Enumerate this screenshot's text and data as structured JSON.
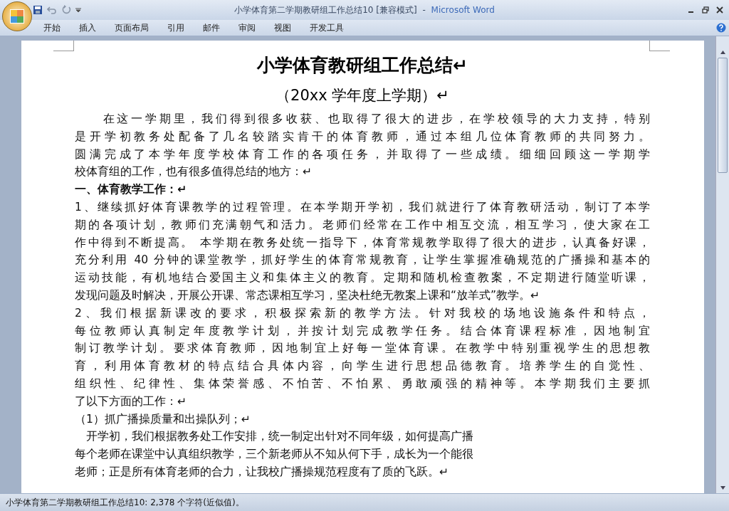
{
  "window": {
    "title": "小学体育第二学期教研组工作总结10 [兼容模式]",
    "separator": "-",
    "app_name": "Microsoft Word"
  },
  "ribbon_tabs": [
    {
      "label": "开始",
      "selected": false
    },
    {
      "label": "插入",
      "selected": false
    },
    {
      "label": "页面布局",
      "selected": false
    },
    {
      "label": "引用",
      "selected": false
    },
    {
      "label": "邮件",
      "selected": false
    },
    {
      "label": "审阅",
      "selected": false
    },
    {
      "label": "视图",
      "selected": false
    },
    {
      "label": "开发工具",
      "selected": false
    }
  ],
  "document": {
    "title": "小学体育教研组工作总结↵",
    "subtitle": "（20xx 学年度上学期）↵",
    "paragraphs": [
      {
        "kind": "body",
        "lines": [
          "　　在这一学期里，我们得到很多收获、也取得了很大的进步，在学校领导的大力支持，特别",
          "是开学初教务处配备了几名较踏实肯干的体育教师，通过本组几位体育教师的共同努力。",
          "圆满完成了本学年度学校体育工作的各项任务，并取得了一些成绩。细细回顾这一学期学",
          "校体育组的工作，也有很多值得总结的地方：↵"
        ]
      },
      {
        "kind": "heading",
        "lines": [
          "一、体育教学工作：↵"
        ]
      },
      {
        "kind": "body",
        "lines": [
          "1、继续抓好体育课教学的过程管理。在本学期开学初，我们就进行了体育教研活动，制订了本学",
          "期的各项计划，教师们充满朝气和活力。老师们经常在工作中相互交流，相互学习，使大家在工",
          "作中得到不断提高。 本学期在教务处统一指导下，体育常规教学取得了很大的进步，认真备好课，",
          "充分利用 40 分钟的课堂教学，抓好学生的体育常规教育，让学生掌握准确规范的广播操和基本的",
          "运动技能，有机地结合爱国主义和集体主义的教育。定期和随机检查教案，不定期进行随堂听课，",
          "发现问题及时解决，开展公开课、常态课相互学习，坚决杜绝无教案上课和“放羊式”教学。↵"
        ]
      },
      {
        "kind": "body",
        "lines": [
          "2、我们根据新课改的要求，积极探索新的教学方法。针对我校的场地设施条件和特点，",
          "每位教师认真制定年度教学计划，并按计划完成教学任务。结合体育课程标准，因地制宜",
          "制订教学计划。要求体育教师，因地制宜上好每一堂体育课。在教学中特别重视学生的思想教",
          "育，利用体育教材的特点结合具体内容，向学生进行思想品德教育。培养学生的自觉性、",
          "组织性、纪律性、集体荣誉感、不怕苦、不怕累、勇敢顽强的精神等。本学期我们主要抓",
          "了以下方面的工作：↵"
        ]
      },
      {
        "kind": "item",
        "lines": [
          "（1）抓广播操质量和出操队列；↵"
        ]
      },
      {
        "kind": "partial",
        "lines": [
          "　开学初，我们根据教务处工作安排，统一制定出针对不同年级，如何提高广播",
          "每个老师在课堂中认真组织教学，三个新老师从不知从何下手，成长为一个能很",
          "老师；正是所有体育老师的合力，让我校广播操规范程度有了质的飞跃。↵"
        ]
      }
    ]
  },
  "status_bar": {
    "text": "小学体育第二学期教研组工作总结10: 2,378 个字符(近似值)。"
  }
}
